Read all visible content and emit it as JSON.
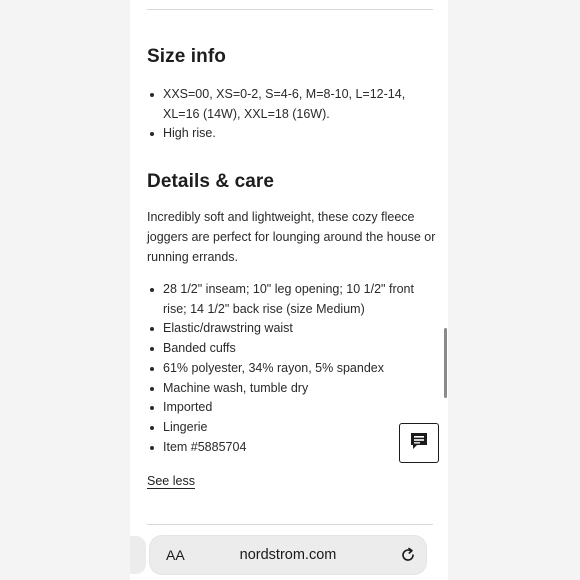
{
  "size_info": {
    "heading": "Size info",
    "items": [
      "XXS=00, XS=0-2, S=4-6, M=8-10, L=12-14, XL=16 (14W), XXL=18 (16W).",
      "High rise."
    ]
  },
  "details_care": {
    "heading": "Details & care",
    "description": "Incredibly soft and lightweight, these cozy fleece joggers are perfect for lounging around the house or running errands.",
    "items": [
      "28 1/2\" inseam; 10\" leg opening; 10 1/2\" front rise; 14 1/2\" back rise (size Medium)",
      "Elastic/drawstring waist",
      "Banded cuffs",
      "61% polyester, 34% rayon, 5% spandex",
      "Machine wash, tumble dry",
      "Imported",
      "Lingerie",
      "Item #5885704"
    ],
    "see_less_label": "See less"
  },
  "browser": {
    "text_size_label": "AA",
    "url": "nordstrom.com"
  },
  "icons": {
    "chat": "chat-icon",
    "reload": "reload-icon"
  }
}
